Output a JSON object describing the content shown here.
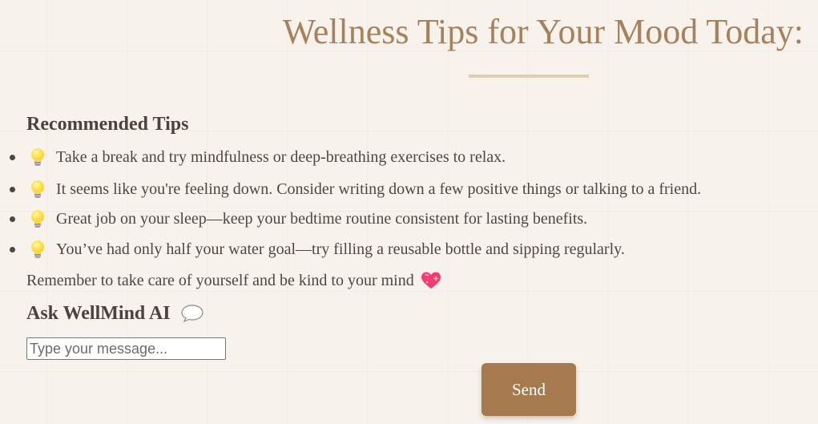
{
  "header": {
    "title": "Wellness Tips for Your Mood Today:"
  },
  "tips_section": {
    "heading": "Recommended Tips",
    "tips": [
      {
        "icon": "lightbulb-icon",
        "text": "Take a break and try mindfulness or deep-breathing exercises to relax."
      },
      {
        "icon": "lightbulb-icon",
        "text": "It seems like you're feeling down. Consider writing down a few positive things or talking to a friend."
      },
      {
        "icon": "lightbulb-icon",
        "text": "Great job on your sleep—keep your bedtime routine consistent for lasting benefits."
      },
      {
        "icon": "lightbulb-icon",
        "text": "You’ve had only half your water goal—try filling a reusable bottle and sipping regularly."
      }
    ],
    "reminder": "Remember to take care of yourself and be kind to your mind",
    "reminder_icon": "sparkling-heart-icon"
  },
  "ask_section": {
    "heading": "Ask WellMind AI",
    "heading_icon": "speech-bubble-icon",
    "input": {
      "value": "",
      "placeholder": "Type your message..."
    },
    "send_label": "Send"
  },
  "colors": {
    "background": "#f8f2ec",
    "title": "#a6815b",
    "divider": "#e3cbb4",
    "text": "#4e4646",
    "button": "#a6794e"
  }
}
